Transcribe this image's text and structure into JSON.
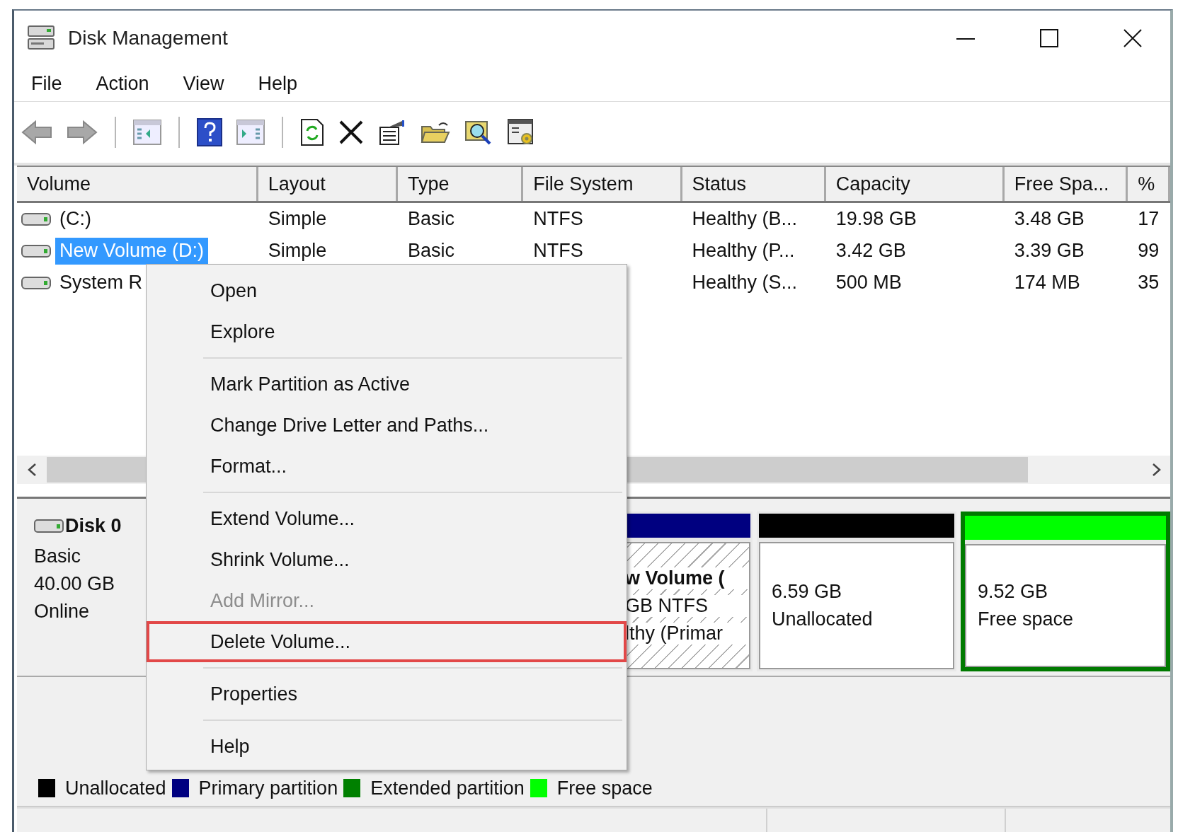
{
  "window": {
    "title": "Disk Management"
  },
  "menu_bar": [
    "File",
    "Action",
    "View",
    "Help"
  ],
  "volume_list": {
    "columns": [
      "Volume",
      "Layout",
      "Type",
      "File System",
      "Status",
      "Capacity",
      "Free Spa...",
      "%"
    ],
    "rows": [
      {
        "selected": false,
        "cells": [
          "(C:)",
          "Simple",
          "Basic",
          "NTFS",
          "Healthy (B...",
          "19.98 GB",
          "3.48 GB",
          "17"
        ]
      },
      {
        "selected": true,
        "cells": [
          "New Volume (D:)",
          "Simple",
          "Basic",
          "NTFS",
          "Healthy (P...",
          "3.42 GB",
          "3.39 GB",
          "99"
        ]
      },
      {
        "selected": false,
        "cells": [
          "System R",
          null,
          null,
          null,
          "Healthy (S...",
          "500 MB",
          "174 MB",
          "35"
        ]
      }
    ]
  },
  "disk": {
    "name": "Disk 0",
    "type": "Basic",
    "size": "40.00 GB",
    "status": "Online",
    "partitions": [
      {
        "kind": "primary",
        "selected": true,
        "focused": false,
        "title": "w Volume  (",
        "lines": [
          "GB NTFS",
          "lthy (Primar"
        ]
      },
      {
        "kind": "unallocated",
        "selected": false,
        "focused": false,
        "lines": [
          "6.59 GB",
          "Unallocated"
        ]
      },
      {
        "kind": "free",
        "selected": false,
        "focused": true,
        "lines": [
          "9.52 GB",
          "Free space"
        ]
      }
    ]
  },
  "legend": [
    {
      "label": "Unallocated",
      "color": "#000000"
    },
    {
      "label": "Primary partition",
      "color": "#000080"
    },
    {
      "label": "Extended partition",
      "color": "#008000"
    },
    {
      "label": "Free space",
      "color": "#00ff00"
    }
  ],
  "context_menu": {
    "items": [
      {
        "kind": "item",
        "label": "Open",
        "disabled": false,
        "annotated": false
      },
      {
        "kind": "item",
        "label": "Explore",
        "disabled": false,
        "annotated": false
      },
      {
        "kind": "separator"
      },
      {
        "kind": "item",
        "label": "Mark Partition as Active",
        "disabled": false,
        "annotated": false
      },
      {
        "kind": "item",
        "label": "Change Drive Letter and Paths...",
        "disabled": false,
        "annotated": false
      },
      {
        "kind": "item",
        "label": "Format...",
        "disabled": false,
        "annotated": false
      },
      {
        "kind": "separator"
      },
      {
        "kind": "item",
        "label": "Extend Volume...",
        "disabled": false,
        "annotated": false
      },
      {
        "kind": "item",
        "label": "Shrink Volume...",
        "disabled": false,
        "annotated": false
      },
      {
        "kind": "item",
        "label": "Add Mirror...",
        "disabled": true,
        "annotated": false
      },
      {
        "kind": "item",
        "label": "Delete Volume...",
        "disabled": false,
        "annotated": true
      },
      {
        "kind": "separator"
      },
      {
        "kind": "item",
        "label": "Properties",
        "disabled": false,
        "annotated": false
      },
      {
        "kind": "separator"
      },
      {
        "kind": "item",
        "label": "Help",
        "disabled": false,
        "annotated": false
      }
    ]
  }
}
